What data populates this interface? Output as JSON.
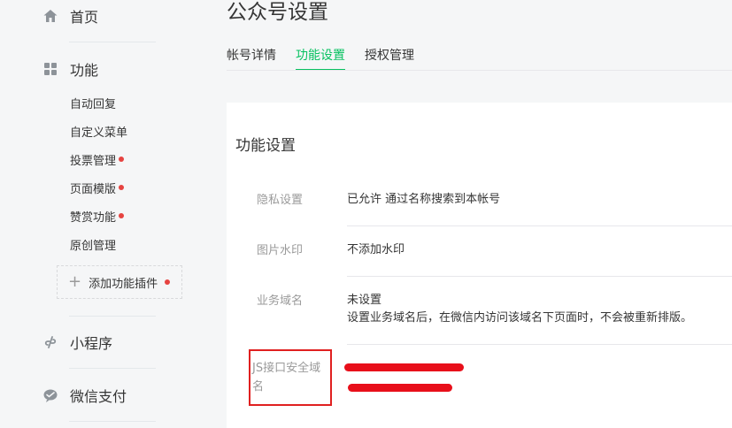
{
  "sidebar": {
    "home": {
      "icon": "home-icon",
      "label": "首页"
    },
    "functions": {
      "icon": "grid-icon",
      "label": "功能",
      "items": [
        {
          "label": "自动回复",
          "dot": false
        },
        {
          "label": "自定义菜单",
          "dot": false
        },
        {
          "label": "投票管理",
          "dot": true
        },
        {
          "label": "页面模版",
          "dot": true
        },
        {
          "label": "赞赏功能",
          "dot": true
        },
        {
          "label": "原创管理",
          "dot": false
        }
      ],
      "add_plugin": "添加功能插件"
    },
    "mini_program": {
      "icon": "link-icon",
      "label": "小程序"
    },
    "wechat_pay": {
      "icon": "wechat-pay-icon",
      "label": "微信支付"
    }
  },
  "page": {
    "title": "公众号设置",
    "tabs": [
      {
        "label": "帐号详情",
        "active": false
      },
      {
        "label": "功能设置",
        "active": true
      },
      {
        "label": "授权管理",
        "active": false
      }
    ]
  },
  "settings": {
    "title": "功能设置",
    "rows": [
      {
        "label": "隐私设置",
        "value": "已允许 通过名称搜索到本帐号"
      },
      {
        "label": "图片水印",
        "value": "不添加水印"
      },
      {
        "label": "业务域名",
        "value": "未设置",
        "desc": "设置业务域名后，在微信内访问该域名下页面时，不会被重新排版。"
      },
      {
        "label": "JS接口安全域名",
        "value": ""
      }
    ]
  },
  "colors": {
    "accent": "#07c160",
    "badge": "#e64340",
    "highlight": "#e02020",
    "redaction": "#e80f1a"
  }
}
